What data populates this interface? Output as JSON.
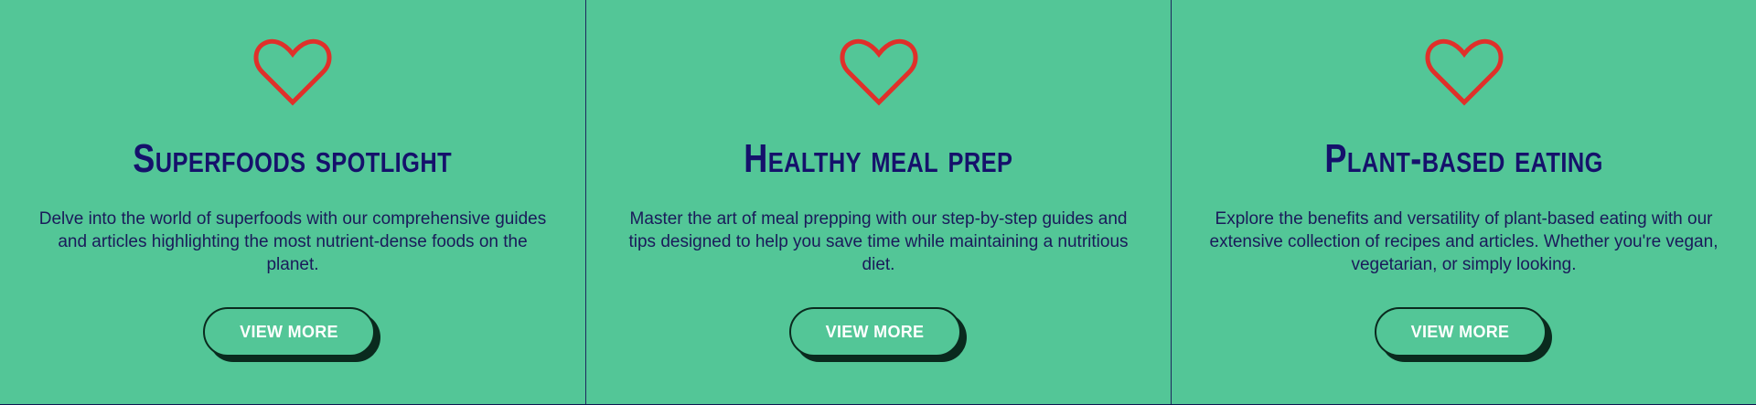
{
  "colors": {
    "background": "#53C697",
    "title": "#15116B",
    "text": "#1A1A5A",
    "heart": "#E0302A",
    "button_border": "#0A2A1E",
    "button_text": "#FFFFFF"
  },
  "cards": [
    {
      "icon": "heart-icon",
      "title": "Superfoods spotlight",
      "description": "Delve into the world of superfoods with our comprehensive guides and articles highlighting the most nutrient-dense foods on the planet.",
      "button_label": "VIEW MORE"
    },
    {
      "icon": "heart-icon",
      "title": "Healthy meal prep",
      "description": "Master the art of meal prepping with our step-by-step guides and tips designed to help you save time while maintaining a nutritious diet.",
      "button_label": "VIEW MORE"
    },
    {
      "icon": "heart-icon",
      "title": "Plant-based eating",
      "description": "Explore the benefits and versatility of plant-based eating with our extensive collection of recipes and articles. Whether you're vegan, vegetarian, or simply looking.",
      "button_label": "VIEW MORE"
    }
  ]
}
